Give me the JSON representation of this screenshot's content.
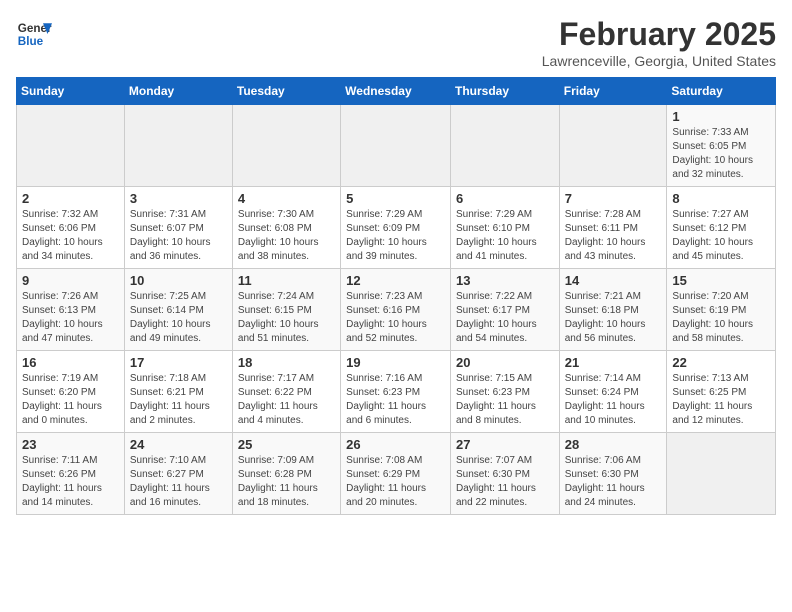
{
  "header": {
    "logo_line1": "General",
    "logo_line2": "Blue",
    "month": "February 2025",
    "location": "Lawrenceville, Georgia, United States"
  },
  "weekdays": [
    "Sunday",
    "Monday",
    "Tuesday",
    "Wednesday",
    "Thursday",
    "Friday",
    "Saturday"
  ],
  "weeks": [
    [
      {
        "day": "",
        "info": ""
      },
      {
        "day": "",
        "info": ""
      },
      {
        "day": "",
        "info": ""
      },
      {
        "day": "",
        "info": ""
      },
      {
        "day": "",
        "info": ""
      },
      {
        "day": "",
        "info": ""
      },
      {
        "day": "1",
        "info": "Sunrise: 7:33 AM\nSunset: 6:05 PM\nDaylight: 10 hours and 32 minutes."
      }
    ],
    [
      {
        "day": "2",
        "info": "Sunrise: 7:32 AM\nSunset: 6:06 PM\nDaylight: 10 hours and 34 minutes."
      },
      {
        "day": "3",
        "info": "Sunrise: 7:31 AM\nSunset: 6:07 PM\nDaylight: 10 hours and 36 minutes."
      },
      {
        "day": "4",
        "info": "Sunrise: 7:30 AM\nSunset: 6:08 PM\nDaylight: 10 hours and 38 minutes."
      },
      {
        "day": "5",
        "info": "Sunrise: 7:29 AM\nSunset: 6:09 PM\nDaylight: 10 hours and 39 minutes."
      },
      {
        "day": "6",
        "info": "Sunrise: 7:29 AM\nSunset: 6:10 PM\nDaylight: 10 hours and 41 minutes."
      },
      {
        "day": "7",
        "info": "Sunrise: 7:28 AM\nSunset: 6:11 PM\nDaylight: 10 hours and 43 minutes."
      },
      {
        "day": "8",
        "info": "Sunrise: 7:27 AM\nSunset: 6:12 PM\nDaylight: 10 hours and 45 minutes."
      }
    ],
    [
      {
        "day": "9",
        "info": "Sunrise: 7:26 AM\nSunset: 6:13 PM\nDaylight: 10 hours and 47 minutes."
      },
      {
        "day": "10",
        "info": "Sunrise: 7:25 AM\nSunset: 6:14 PM\nDaylight: 10 hours and 49 minutes."
      },
      {
        "day": "11",
        "info": "Sunrise: 7:24 AM\nSunset: 6:15 PM\nDaylight: 10 hours and 51 minutes."
      },
      {
        "day": "12",
        "info": "Sunrise: 7:23 AM\nSunset: 6:16 PM\nDaylight: 10 hours and 52 minutes."
      },
      {
        "day": "13",
        "info": "Sunrise: 7:22 AM\nSunset: 6:17 PM\nDaylight: 10 hours and 54 minutes."
      },
      {
        "day": "14",
        "info": "Sunrise: 7:21 AM\nSunset: 6:18 PM\nDaylight: 10 hours and 56 minutes."
      },
      {
        "day": "15",
        "info": "Sunrise: 7:20 AM\nSunset: 6:19 PM\nDaylight: 10 hours and 58 minutes."
      }
    ],
    [
      {
        "day": "16",
        "info": "Sunrise: 7:19 AM\nSunset: 6:20 PM\nDaylight: 11 hours and 0 minutes."
      },
      {
        "day": "17",
        "info": "Sunrise: 7:18 AM\nSunset: 6:21 PM\nDaylight: 11 hours and 2 minutes."
      },
      {
        "day": "18",
        "info": "Sunrise: 7:17 AM\nSunset: 6:22 PM\nDaylight: 11 hours and 4 minutes."
      },
      {
        "day": "19",
        "info": "Sunrise: 7:16 AM\nSunset: 6:23 PM\nDaylight: 11 hours and 6 minutes."
      },
      {
        "day": "20",
        "info": "Sunrise: 7:15 AM\nSunset: 6:23 PM\nDaylight: 11 hours and 8 minutes."
      },
      {
        "day": "21",
        "info": "Sunrise: 7:14 AM\nSunset: 6:24 PM\nDaylight: 11 hours and 10 minutes."
      },
      {
        "day": "22",
        "info": "Sunrise: 7:13 AM\nSunset: 6:25 PM\nDaylight: 11 hours and 12 minutes."
      }
    ],
    [
      {
        "day": "23",
        "info": "Sunrise: 7:11 AM\nSunset: 6:26 PM\nDaylight: 11 hours and 14 minutes."
      },
      {
        "day": "24",
        "info": "Sunrise: 7:10 AM\nSunset: 6:27 PM\nDaylight: 11 hours and 16 minutes."
      },
      {
        "day": "25",
        "info": "Sunrise: 7:09 AM\nSunset: 6:28 PM\nDaylight: 11 hours and 18 minutes."
      },
      {
        "day": "26",
        "info": "Sunrise: 7:08 AM\nSunset: 6:29 PM\nDaylight: 11 hours and 20 minutes."
      },
      {
        "day": "27",
        "info": "Sunrise: 7:07 AM\nSunset: 6:30 PM\nDaylight: 11 hours and 22 minutes."
      },
      {
        "day": "28",
        "info": "Sunrise: 7:06 AM\nSunset: 6:30 PM\nDaylight: 11 hours and 24 minutes."
      },
      {
        "day": "",
        "info": ""
      }
    ]
  ]
}
